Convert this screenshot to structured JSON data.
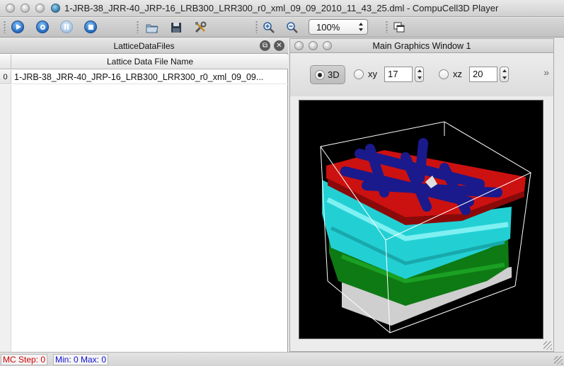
{
  "window": {
    "title": "1-JRB-38_JRR-40_JRP-16_LRB300_LRR300_r0_xml_09_09_2010_11_43_25.dml - CompuCell3D Player"
  },
  "toolbar": {
    "zoom_value": "100%",
    "buttons": [
      "run",
      "step",
      "pause",
      "stop",
      "open",
      "save",
      "configure",
      "zoom-in",
      "zoom-out",
      "new-graphics-window"
    ]
  },
  "left_panel": {
    "title": "LatticeDataFiles",
    "column_header": "Lattice Data File Name",
    "rows": [
      {
        "index": "0",
        "name": "1-JRB-38_JRR-40_JRP-16_LRB300_LRR300_r0_xml_09_09..."
      }
    ]
  },
  "graphics_window": {
    "title": "Main Graphics Window 1",
    "mode_3d_label": "3D",
    "xy_label": "xy",
    "xy_value": "17",
    "xz_label": "xz",
    "xz_value": "20",
    "more_label": "»",
    "colors": {
      "background": "#000000",
      "red_cells": "#cc1111",
      "blue_cells": "#1a1a8c",
      "cyan_cells": "#22d0d4",
      "green_cells": "#0e7a14",
      "wireframe": "#ffffff"
    }
  },
  "status": {
    "mc_step": "MC Step: 0",
    "min_max": "Min: 0 Max: 0"
  }
}
